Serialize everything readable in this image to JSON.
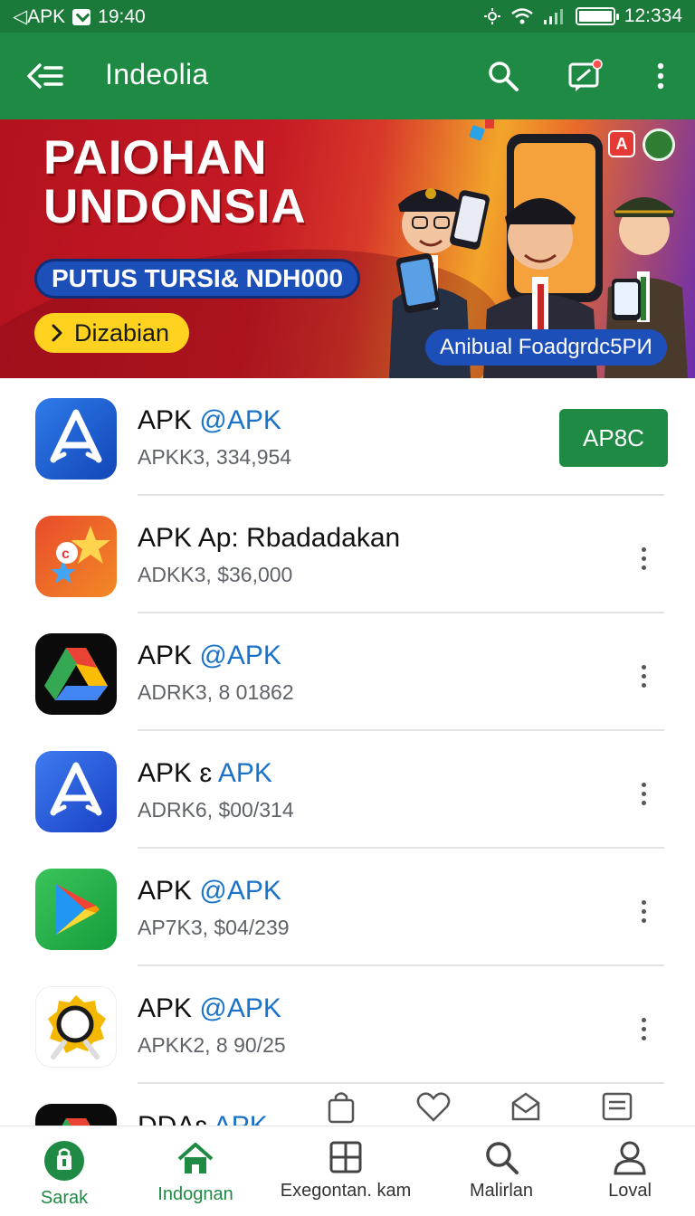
{
  "status_bar": {
    "left_label": "◁APK",
    "time_left": "19:40",
    "time_right": "12:334"
  },
  "app_bar": {
    "title": "Indeolia"
  },
  "banner": {
    "headline_line1": "PAIOHAN",
    "headline_line2": "UNDONSIA",
    "pill_blue": "PUTUS TURSI& NDH000",
    "cta": "Dizabian",
    "caption": "Anibual Foadgrdc5PИ",
    "badge": "A"
  },
  "apps": [
    {
      "name": "APK ",
      "name_accent": "@APK",
      "sub": "APKK3, 334,954",
      "action": "AP8C"
    },
    {
      "name": "APK Ap: Rbadadakan",
      "name_accent": "",
      "sub": "ADKK3, $36,000"
    },
    {
      "name": "APK ",
      "name_accent": "@APK",
      "sub": "ADRK3, 8 01862"
    },
    {
      "name": "APK ɛ ",
      "name_accent": "APK",
      "sub": "ADRK6, $00/314"
    },
    {
      "name": "APK ",
      "name_accent": "@APK",
      "sub": "AP7K3, $04/239"
    },
    {
      "name": "APK ",
      "name_accent": "@APK",
      "sub": "APKK2, 8 90/25"
    },
    {
      "name": "DDAɛ ",
      "name_accent": "APK",
      "sub": ""
    }
  ],
  "bottom_nav": [
    {
      "label": "Sarak",
      "active": true
    },
    {
      "label": "Indognan",
      "active": true
    },
    {
      "label": "Exegontan. kam",
      "active": false
    },
    {
      "label": "Malirlan",
      "active": false
    },
    {
      "label": "Loval",
      "active": false
    }
  ],
  "colors": {
    "primary": "#1e8a43",
    "status": "#1b7a3a",
    "accent_text": "#1a73c9"
  }
}
